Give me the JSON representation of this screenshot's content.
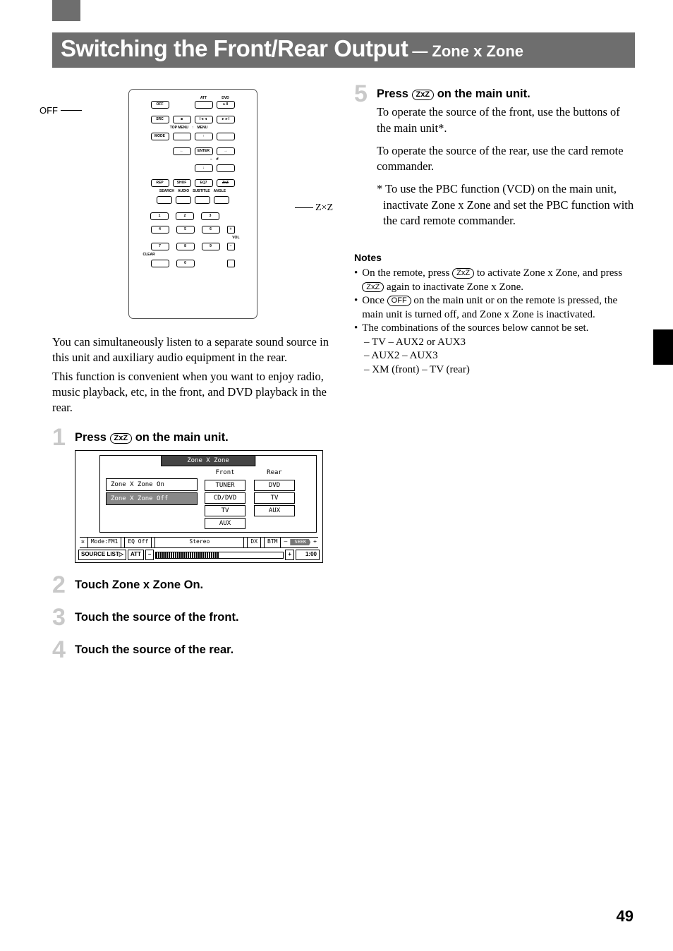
{
  "header": {
    "main": "Switching the Front/Rear Output",
    "sub": "— Zone x Zone"
  },
  "remote": {
    "callout_off": "OFF",
    "callout_zxz": "Z×Z",
    "r1": {
      "off": "OFF",
      "att": "ATT",
      "dvd": "DVD",
      "playpause": "►II"
    },
    "r2": {
      "src": "SRC",
      "stop": "■",
      "prev": "I◄◄",
      "next": "►►I"
    },
    "r2l": {
      "topmenu": "TOP MENU",
      "up": "↑",
      "menu": "MENU"
    },
    "r3": {
      "mode": "MODE"
    },
    "r4": {
      "left": "←",
      "enter": "ENTER",
      "right": "→"
    },
    "r5": {
      "down": "↓",
      "ret": "↺"
    },
    "r6": {
      "rep": "REP",
      "shuf": "SHUF",
      "eq7": "EQ7",
      "zxz": "ZxZ"
    },
    "r6l": {
      "search": "SEARCH",
      "audio": "AUDIO",
      "subtitle": "SUBTITLE",
      "angle": "ANGLE"
    },
    "n": [
      "1",
      "2",
      "3",
      "4",
      "5",
      "6",
      "7",
      "8",
      "9",
      "0"
    ],
    "plus": "+",
    "vol": "VOL",
    "minus": "–",
    "clear": "CLEAR"
  },
  "intro": {
    "p1": "You can simultaneously listen to a separate sound source in this unit and auxiliary audio equipment in the rear.",
    "p2": "This function is convenient when you want to enjoy radio, music playback, etc, in the front, and DVD playback in the rear."
  },
  "steps": {
    "s1": {
      "num": "1",
      "pre": "Press ",
      "key": "ZxZ",
      "post": " on the main unit."
    },
    "s2": {
      "num": "2",
      "title": "Touch Zone x Zone On."
    },
    "s3": {
      "num": "3",
      "title": "Touch the source of the front."
    },
    "s4": {
      "num": "4",
      "title": "Touch the source of the rear."
    },
    "s5": {
      "num": "5",
      "pre": "Press ",
      "key": "ZxZ",
      "post": " on the main unit.",
      "p1": "To operate the source of the front, use the buttons of the main unit*.",
      "p2": "To operate the source of the rear, use the card remote commander.",
      "asterisk": "* To use the PBC function (VCD) on the main unit, inactivate Zone x Zone and set the PBC function with the card remote commander."
    }
  },
  "screenshot": {
    "title": "Zone X Zone",
    "list_on": "Zone X Zone On",
    "list_off": "Zone X Zone Off",
    "front_h": "Front",
    "rear_h": "Rear",
    "front": [
      "TUNER",
      "CD/DVD",
      "TV",
      "AUX"
    ],
    "rear": [
      "DVD",
      "TV",
      "AUX"
    ],
    "status": {
      "mode": "Mode:FM1",
      "eq": "EQ Off",
      "stereo": "Stereo",
      "dx": "DX",
      "btm": "BTM",
      "seek": "SEEK",
      "minus": "–",
      "plus": "+"
    },
    "bottom": {
      "sourcelist": "SOURCE LIST▷",
      "att": "ATT",
      "minus": "–",
      "plus": "+",
      "time": "1:00"
    }
  },
  "notes": {
    "heading": "Notes",
    "n1a": "On the remote, press ",
    "n1key": "ZxZ",
    "n1b": " to activate Zone x Zone, and press ",
    "n1c": " again to inactivate Zone x Zone.",
    "n2a": "Once ",
    "n2key": "OFF",
    "n2b": " on the main unit or on the remote is pressed, the main unit is turned off, and Zone x Zone is inactivated.",
    "n3": "The combinations of the sources below cannot be set.",
    "n3a": "– TV – AUX2 or AUX3",
    "n3b": "– AUX2 – AUX3",
    "n3c": "– XM (front) – TV (rear)"
  },
  "pagenum": "49"
}
